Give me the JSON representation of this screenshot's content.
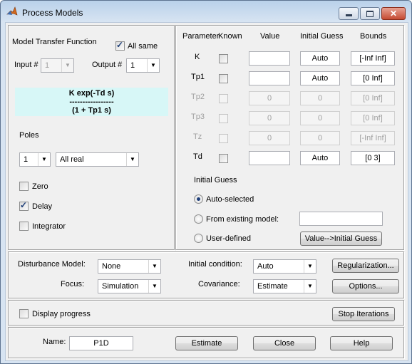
{
  "window": {
    "title": "Process Models",
    "minimize": "▬",
    "maximize": "□",
    "close": "✕",
    "icon": "matlab-logo-icon"
  },
  "model": {
    "heading": "Model Transfer Function",
    "all_same_label": "All same",
    "all_same_checked": true,
    "input_label": "Input #",
    "input_value": "1",
    "output_label": "Output #",
    "output_value": "1",
    "formula_line1": "K exp(-Td s)",
    "formula_line2": "-----------------",
    "formula_line3": "(1 + Tp1 s)",
    "poles_label": "Poles",
    "poles_count": "1",
    "poles_type": "All real",
    "zero_label": "Zero",
    "delay_label": "Delay",
    "integrator_label": "Integrator"
  },
  "params": {
    "headers": {
      "parameter": "Parameter",
      "known": "Known",
      "value": "Value",
      "initial": "Initial Guess",
      "bounds": "Bounds"
    },
    "rows": [
      {
        "name": "K",
        "value": "",
        "initial": "Auto",
        "bounds": "[-Inf Inf]",
        "enabled": true
      },
      {
        "name": "Tp1",
        "value": "",
        "initial": "Auto",
        "bounds": "[0 Inf]",
        "enabled": true
      },
      {
        "name": "Tp2",
        "value": "0",
        "initial": "0",
        "bounds": "[0 Inf]",
        "enabled": false
      },
      {
        "name": "Tp3",
        "value": "0",
        "initial": "0",
        "bounds": "[0 Inf]",
        "enabled": false
      },
      {
        "name": "Tz",
        "value": "0",
        "initial": "0",
        "bounds": "[-Inf Inf]",
        "enabled": false
      },
      {
        "name": "Td",
        "value": "",
        "initial": "Auto",
        "bounds": "[0 3]",
        "enabled": true
      }
    ],
    "initial_guess_title": "Initial Guess",
    "auto_selected": "Auto-selected",
    "from_existing": "From existing model:",
    "from_existing_value": "",
    "user_defined": "User-defined",
    "value_to_initial_button": "Value-->Initial Guess"
  },
  "options": {
    "disturbance_label": "Disturbance Model:",
    "disturbance_value": "None",
    "focus_label": "Focus:",
    "focus_value": "Simulation",
    "initial_condition_label": "Initial condition:",
    "initial_condition_value": "Auto",
    "covariance_label": "Covariance:",
    "covariance_value": "Estimate",
    "regularization_button": "Regularization...",
    "options_button": "Options..."
  },
  "progress": {
    "display_label": "Display progress",
    "stop_button": "Stop Iterations"
  },
  "footer": {
    "name_label": "Name:",
    "name_value": "P1D",
    "estimate_button": "Estimate",
    "close_button": "Close",
    "help_button": "Help"
  }
}
